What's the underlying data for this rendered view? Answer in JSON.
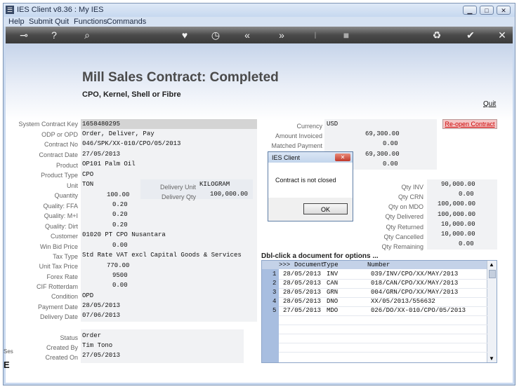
{
  "window": {
    "title": "IES Client v8.36 : My IES",
    "buttons": [
      "▁",
      "□",
      "✕"
    ]
  },
  "menu": [
    "Help",
    "Submit",
    "Quit",
    "Functions",
    "Commands"
  ],
  "toolbar_icons": [
    "key-icon",
    "help-icon",
    "search-icon",
    "heart-icon",
    "clock-icon",
    "rewind-icon",
    "forward-icon",
    "cursor-icon",
    "stop-icon",
    "recycle-icon",
    "check-icon",
    "close-icon"
  ],
  "page": {
    "heading": "Mill Sales Contract: Completed",
    "subheading": "CPO, Kernel, Shell or Fibre",
    "quit": "Quit",
    "reopen": "Re-open Contract"
  },
  "left_fields": [
    {
      "label": "System Contract Key",
      "value": "1658480295"
    },
    {
      "label": "ODP or OPD",
      "value": "Order, Deliver, Pay"
    },
    {
      "label": "Contract No",
      "value": "046/SPK/XX-010/CPO/05/2013"
    },
    {
      "label": "Contract Date",
      "value": "27/05/2013"
    },
    {
      "label": "Product",
      "value": "OP101 Palm Oil"
    },
    {
      "label": "Product Type",
      "value": "CPO"
    },
    {
      "label": "Unit",
      "value": "TON"
    },
    {
      "label": "Quantity",
      "value": "100.00"
    },
    {
      "label": "Quality: FFA",
      "value": "0.20"
    },
    {
      "label": "Quality: M+I",
      "value": "0.20"
    },
    {
      "label": "Quality: Dirt",
      "value": "0.20"
    },
    {
      "label": "Customer",
      "value": "01020 PT CPO Nusantara"
    },
    {
      "label": "Win Bid Price",
      "value": "0.00"
    },
    {
      "label": "Tax Type",
      "value": "Std Rate VAT excl Capital Goods & Services"
    },
    {
      "label": "Unit Tax Price",
      "value": "770.00"
    },
    {
      "label": "Forex Rate",
      "value": "9500"
    },
    {
      "label": "CIF Rotterdam",
      "value": "0.00"
    },
    {
      "label": "Condition",
      "value": "OPD"
    },
    {
      "label": "Payment Date",
      "value": "28/05/2013"
    },
    {
      "label": "Delivery Date",
      "value": "07/06/2013"
    }
  ],
  "delivery": {
    "unit_label": "Delivery Unit",
    "unit_value": "KILOGRAM",
    "qty_label": "Delivery Qty",
    "qty_value": "100,000.00"
  },
  "status_fields": [
    {
      "label": "Status",
      "value": "Order"
    },
    {
      "label": "Created By",
      "value": "Tim Tono"
    },
    {
      "label": "Created On",
      "value": "27/05/2013"
    }
  ],
  "right_fields": [
    {
      "label": "Currency",
      "value": "USD"
    },
    {
      "label": "Amount Invoiced",
      "value": "69,300.00"
    },
    {
      "label": "Matched Payment",
      "value": "0.00"
    },
    {
      "label": "",
      "value": "69,300.00"
    },
    {
      "label": "",
      "value": "0.00"
    }
  ],
  "qty_fields": [
    {
      "label": "Qty INV",
      "value": "90,000.00"
    },
    {
      "label": "Qty CRN",
      "value": "0.00"
    },
    {
      "label": "Qty on MDO",
      "value": "100,000.00"
    },
    {
      "label": "Qty Delivered",
      "value": "100,000.00"
    },
    {
      "label": "Qty Returned",
      "value": "10,000.00"
    },
    {
      "label": "Qty Cancelled",
      "value": "10,000.00"
    },
    {
      "label": "Qty Remaining",
      "value": "0.00"
    }
  ],
  "documents": {
    "title": "Dbl-click a document for options ...",
    "header": {
      "marker": ">>>",
      "doc": "Document",
      "type": "Type",
      "number": "Number"
    },
    "rows": [
      {
        "n": "1",
        "doc": "28/05/2013",
        "type": "INV",
        "number": "039/INV/CPO/XX/MAY/2013"
      },
      {
        "n": "2",
        "doc": "28/05/2013",
        "type": "CAN",
        "number": "018/CAN/CPO/XX/MAY/2013"
      },
      {
        "n": "3",
        "doc": "28/05/2013",
        "type": "GRN",
        "number": "004/GRN/CPO/XX/MAY/2013"
      },
      {
        "n": "4",
        "doc": "28/05/2013",
        "type": "DNO",
        "number": "XX/05/2013/556632"
      },
      {
        "n": "5",
        "doc": "27/05/2013",
        "type": "MDO",
        "number": "026/DO/XX-010/CPO/05/2013"
      }
    ]
  },
  "dialog": {
    "title": "IES Client",
    "close": "✕",
    "message": "Contract is not closed",
    "ok": "OK"
  },
  "side_fragments": {
    "top": "Ses",
    "bottom": "E"
  }
}
